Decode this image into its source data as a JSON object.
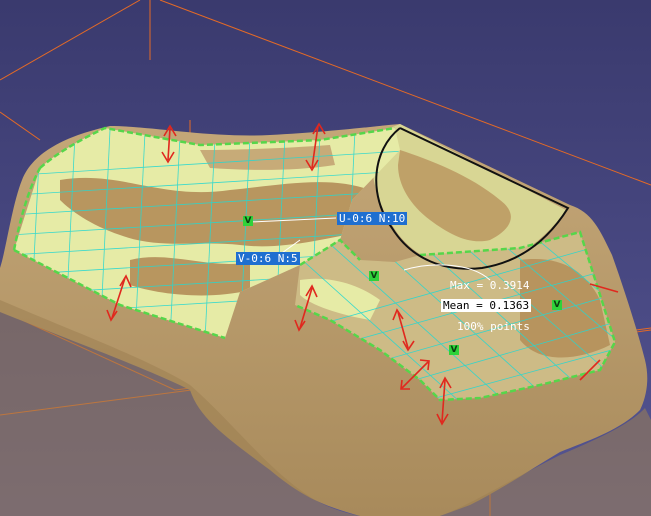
{
  "viewport": {
    "background_top": "#3a3a6e",
    "background_bottom": "#555593",
    "surface_color": "#b99a6a",
    "patch_color": "#e6eba6",
    "grid_color": "#27d7d0",
    "boundary_color": "#56d64a",
    "arrow_color": "#e0281e",
    "bbox_color": "#e46a26"
  },
  "labels": {
    "u_param": "U-0:6 N:10",
    "v_param": "V-0:6 N:5",
    "max": "Max = 0.3914",
    "mean": "Mean = 0.1363",
    "points": "100% points"
  },
  "markers": [
    "V",
    "V",
    "V",
    "V"
  ]
}
